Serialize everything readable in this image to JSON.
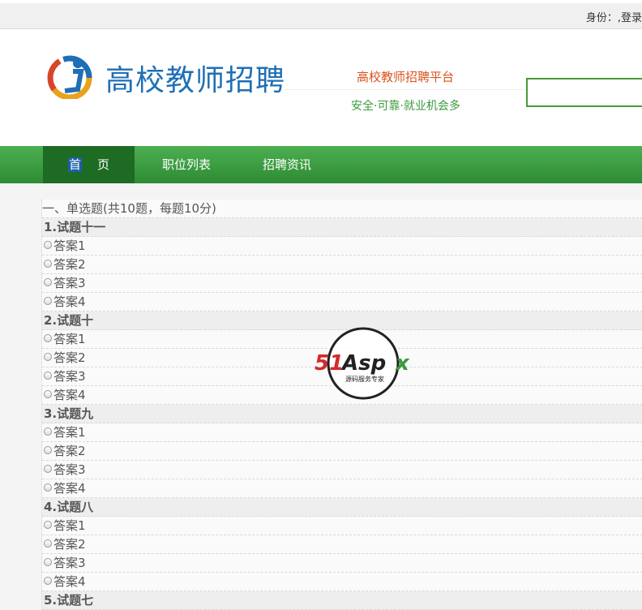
{
  "topbar": {
    "identity": "身份：,登录"
  },
  "header": {
    "site_title": "高校教师招聘",
    "slogan_primary": "高校教师招聘平台",
    "slogan_secondary": "安全·可靠·就业机会多",
    "search": {
      "value": "",
      "placeholder": ""
    }
  },
  "nav": {
    "home_a": "首",
    "home_b": "页",
    "jobs": "职位列表",
    "news": "招聘资讯"
  },
  "quiz": {
    "section_title": "一、单选题(共10题，每题10分)",
    "questions": [
      {
        "title": "1.试题十一",
        "options": [
          "答案1",
          "答案2",
          "答案3",
          "答案4"
        ]
      },
      {
        "title": "2.试题十",
        "options": [
          "答案1",
          "答案2",
          "答案3",
          "答案4"
        ]
      },
      {
        "title": "3.试题九",
        "options": [
          "答案1",
          "答案2",
          "答案3",
          "答案4"
        ]
      },
      {
        "title": "4.试题八",
        "options": [
          "答案1",
          "答案2",
          "答案3",
          "答案4"
        ]
      },
      {
        "title": "5.试题七",
        "options": []
      }
    ]
  },
  "watermark": {
    "brand": "51Aspx",
    "tagline": "源码服务专家"
  },
  "colors": {
    "nav_green": "#3a9b3f",
    "title_blue": "#1f6fb5",
    "slogan_orange": "#d9531e",
    "slogan_green": "#3b9a3b"
  }
}
